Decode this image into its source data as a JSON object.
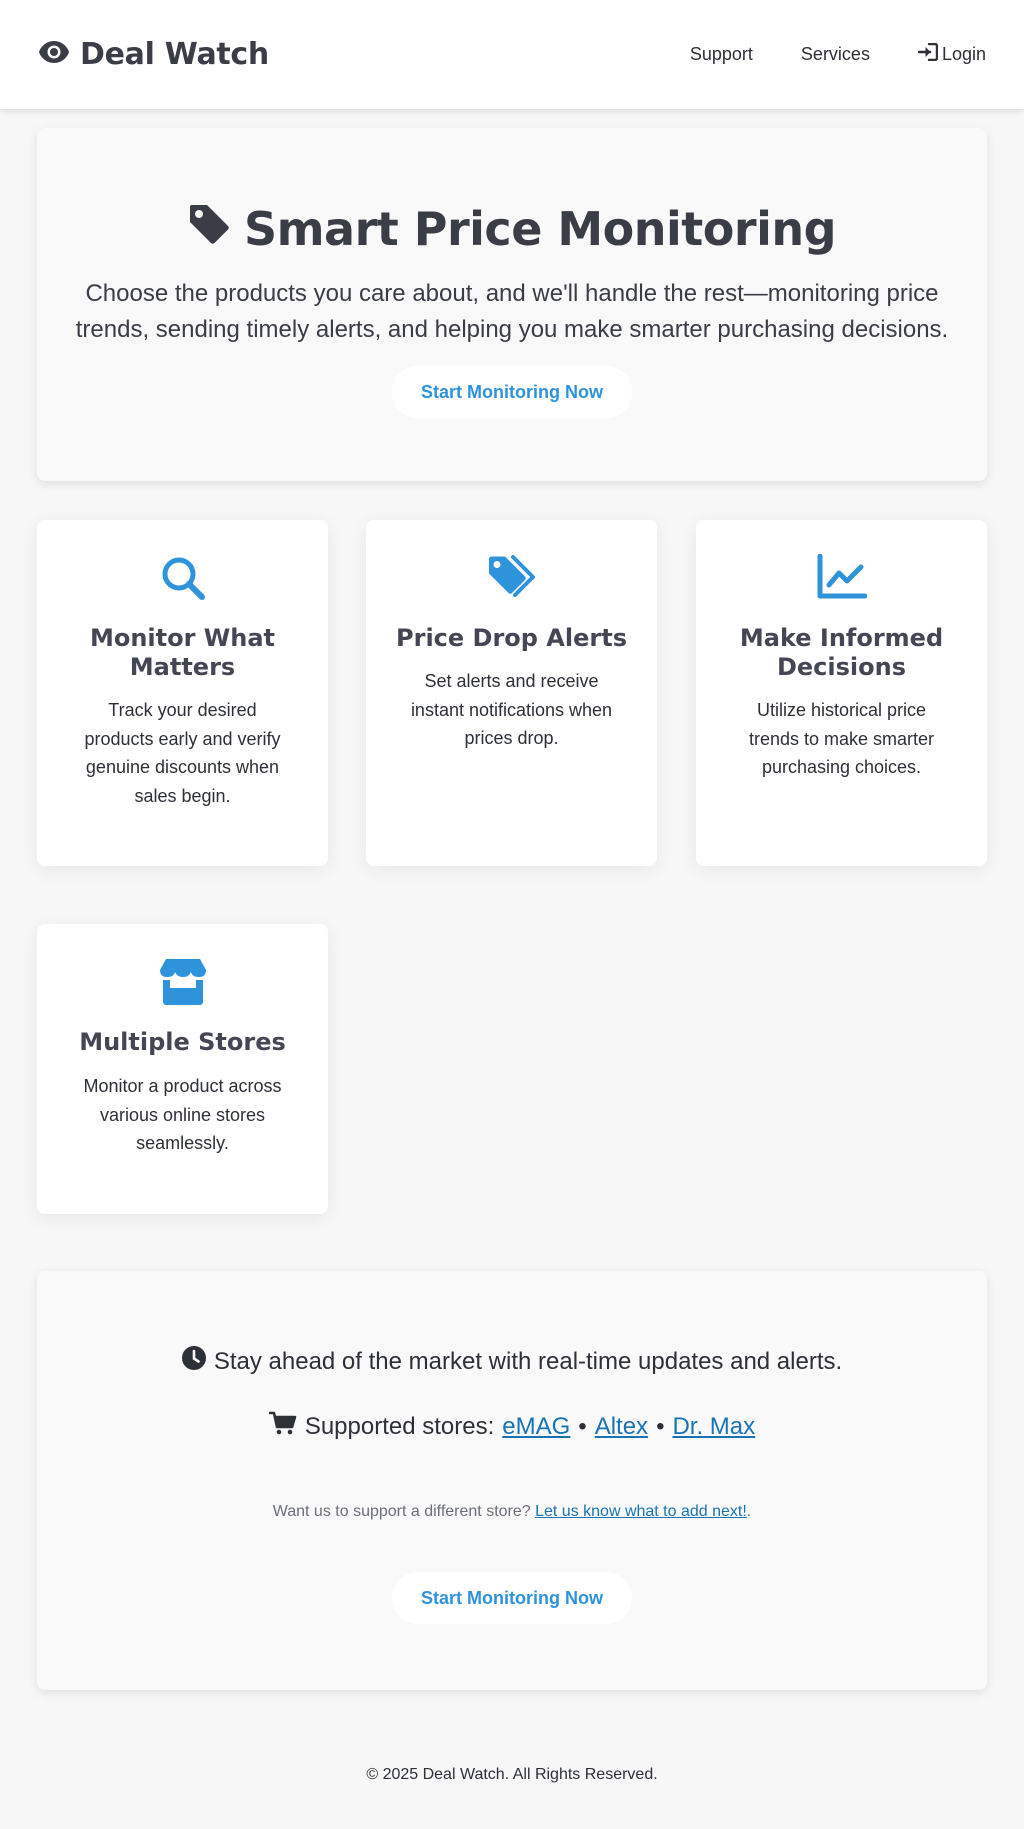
{
  "header": {
    "brand": "Deal Watch",
    "nav": {
      "support": "Support",
      "services": "Services",
      "login": "Login"
    }
  },
  "hero": {
    "title": "Smart Price Monitoring",
    "subtitle": "Choose the products you care about, and we'll handle the rest—monitoring price trends, sending timely alerts, and helping you make smarter purchasing decisions.",
    "cta": "Start Monitoring Now"
  },
  "features": [
    {
      "icon": "search-icon",
      "title": "Monitor What Matters",
      "desc": "Track your desired products early and verify genuine discounts when sales begin."
    },
    {
      "icon": "tags-icon",
      "title": "Price Drop Alerts",
      "desc": "Set alerts and receive instant notifications when prices drop."
    },
    {
      "icon": "chart-line-icon",
      "title": "Make Informed Decisions",
      "desc": "Utilize historical price trends to make smarter purchasing choices."
    },
    {
      "icon": "store-icon",
      "title": "Multiple Stores",
      "desc": "Monitor a product across various online stores seamlessly."
    }
  ],
  "info": {
    "realtime": "Stay ahead of the market with real-time updates and alerts.",
    "stores_label": "Supported stores:",
    "stores": [
      "eMAG",
      "Altex",
      "Dr. Max"
    ],
    "separator": "•",
    "note_prefix": "Want us to support a different store?",
    "note_link": "Let us know what to add next!",
    "note_suffix": ".",
    "cta": "Start Monitoring Now"
  },
  "footer": {
    "copyright": "© 2025 Deal Watch. All Rights Reserved."
  },
  "colors": {
    "accent": "#2f93dc",
    "link": "#1a73b4",
    "text": "#3a3d46",
    "background": "#f7f7f8"
  }
}
